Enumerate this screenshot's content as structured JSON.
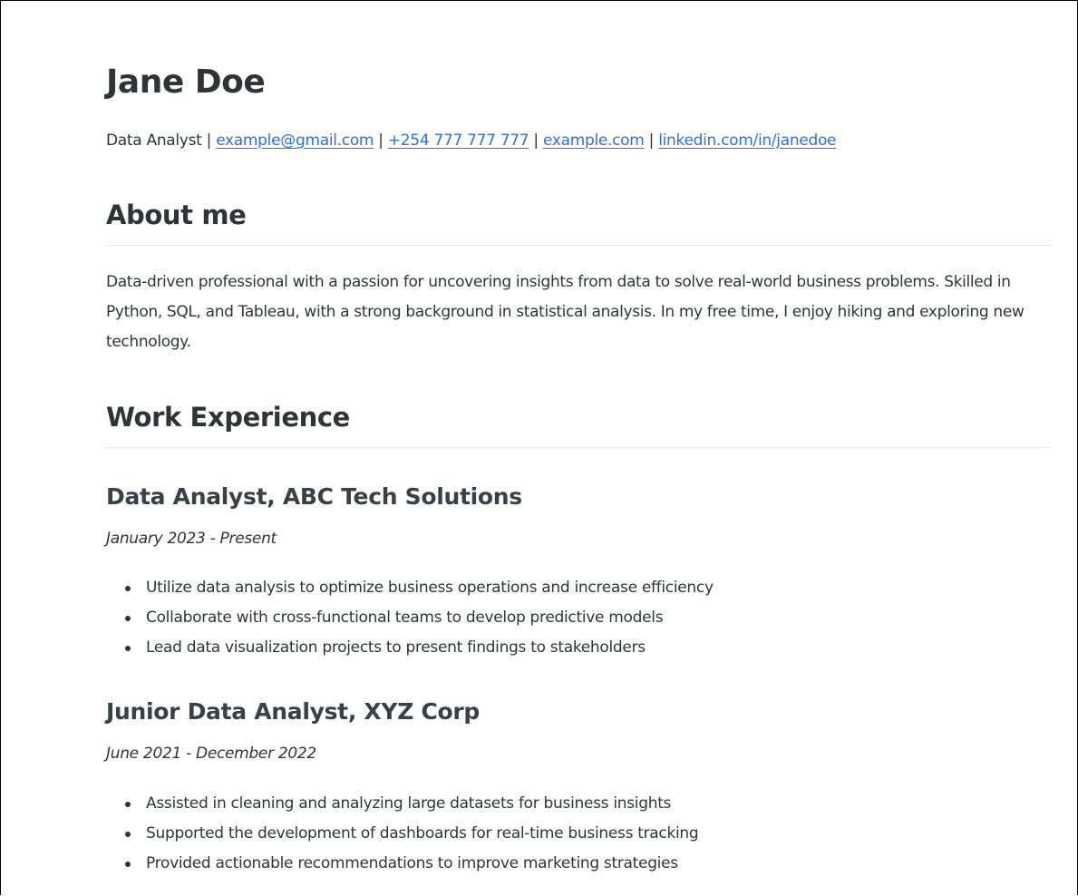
{
  "name": "Jane Doe",
  "contact": {
    "role": "Data Analyst",
    "separator": "|",
    "email": "example@gmail.com",
    "phone": "+254 777 777 777",
    "website": "example.com",
    "linkedin": "linkedin.com/in/janedoe"
  },
  "about": {
    "heading": "About me",
    "text": "Data-driven professional with a passion for uncovering insights from data to solve real-world business problems. Skilled in Python, SQL, and Tableau, with a strong background in statistical analysis. In my free time, I enjoy hiking and exploring new technology."
  },
  "work": {
    "heading": "Work Experience",
    "jobs": [
      {
        "title": "Data Analyst, ABC Tech Solutions",
        "dates": "January 2023 - Present",
        "bullets": [
          "Utilize data analysis to optimize business operations and increase efficiency",
          "Collaborate with cross-functional teams to develop predictive models",
          "Lead data visualization projects to present findings to stakeholders"
        ]
      },
      {
        "title": "Junior Data Analyst, XYZ Corp",
        "dates": "June 2021 - December 2022",
        "bullets": [
          "Assisted in cleaning and analyzing large datasets for business insights",
          "Supported the development of dashboards for real-time business tracking",
          "Provided actionable recommendations to improve marketing strategies"
        ]
      }
    ]
  },
  "colors": {
    "text": "#2f3437",
    "link": "#2f6fdc",
    "rule": "#e3e5e7"
  }
}
